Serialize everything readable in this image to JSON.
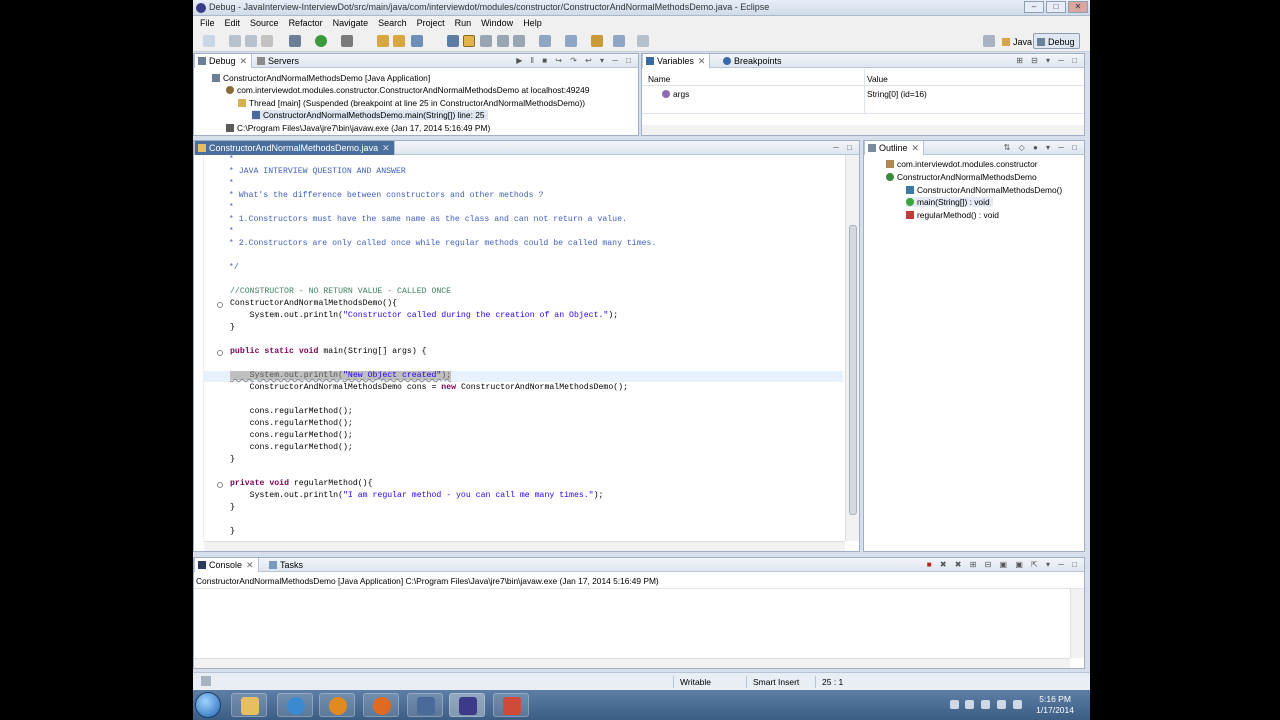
{
  "window": {
    "title": "Debug - JavaInterview-InterviewDot/src/main/java/com/interviewdot/modules/constructor/ConstructorAndNormalMethodsDemo.java - Eclipse",
    "controls": [
      "–",
      "□",
      "✕"
    ]
  },
  "menu": [
    "File",
    "Edit",
    "Source",
    "Refactor",
    "Navigate",
    "Search",
    "Project",
    "Run",
    "Window",
    "Help"
  ],
  "perspectives": {
    "java": "Java",
    "debug": "Debug"
  },
  "debug_view": {
    "tabs": [
      {
        "label": "Debug"
      },
      {
        "label": "Servers"
      }
    ],
    "tree": [
      "ConstructorAndNormalMethodsDemo [Java Application]",
      "com.interviewdot.modules.constructor.ConstructorAndNormalMethodsDemo at localhost:49249",
      "Thread [main] (Suspended (breakpoint at line 25 in ConstructorAndNormalMethodsDemo))",
      "ConstructorAndNormalMethodsDemo.main(String[]) line: 25",
      "C:\\Program Files\\Java\\jre7\\bin\\javaw.exe (Jan 17, 2014 5:16:49 PM)"
    ]
  },
  "variables_view": {
    "tabs": [
      {
        "label": "Variables"
      },
      {
        "label": "Breakpoints"
      }
    ],
    "columns": [
      "Name",
      "Value"
    ],
    "rows": [
      {
        "name": "args",
        "value": "String[0]  (id=16)"
      }
    ]
  },
  "editor": {
    "tab": "ConstructorAndNormalMethodsDemo.java",
    "lines": [
      " *",
      " * JAVA INTERVIEW QUESTION AND ANSWER",
      " *",
      " * What's the difference between constructors and other methods ?",
      " *",
      " * 1.Constructors must have the same name as the class and can not return a value.",
      " *",
      " * 2.Constructors are only called once while regular methods could be called many times.",
      "",
      " */",
      "",
      "//CONSTRUCTOR - NO RETURN VALUE - CALLED ONCE",
      "ConstructorAndNormalMethodsDemo(){",
      "    System.out.println(\"Constructor called during the creation of an Object.\");",
      "}",
      "",
      "public static void main(String[] args) {",
      "",
      "    System.out.println(\"New Object created\");",
      "    ConstructorAndNormalMethodsDemo cons = new ConstructorAndNormalMethodsDemo();",
      "",
      "    cons.regularMethod();",
      "    cons.regularMethod();",
      "    cons.regularMethod();",
      "    cons.regularMethod();",
      "}",
      "",
      "private void regularMethod(){",
      "    System.out.println(\"I am regular method - you can call me many times.\");",
      "}",
      "",
      "}"
    ]
  },
  "outline": {
    "tab": "Outline",
    "items": [
      "com.interviewdot.modules.constructor",
      "ConstructorAndNormalMethodsDemo",
      "ConstructorAndNormalMethodsDemo()",
      "main(String[]) : void",
      "regularMethod() : void"
    ]
  },
  "console": {
    "tabs": [
      {
        "label": "Console"
      },
      {
        "label": "Tasks"
      }
    ],
    "header": "ConstructorAndNormalMethodsDemo [Java Application] C:\\Program Files\\Java\\jre7\\bin\\javaw.exe (Jan 17, 2014 5:16:49 PM)"
  },
  "status": {
    "writable": "Writable",
    "insert_mode": "Smart Insert",
    "position": "25 : 1"
  },
  "taskbar": {
    "time": "5:16 PM",
    "date": "1/17/2014"
  },
  "colors": {
    "comment": "#3f7f5f",
    "javadoc": "#3f5fbf",
    "keyword": "#7f0055",
    "string": "#2a00ff",
    "current_line": "#e8f2fe"
  }
}
